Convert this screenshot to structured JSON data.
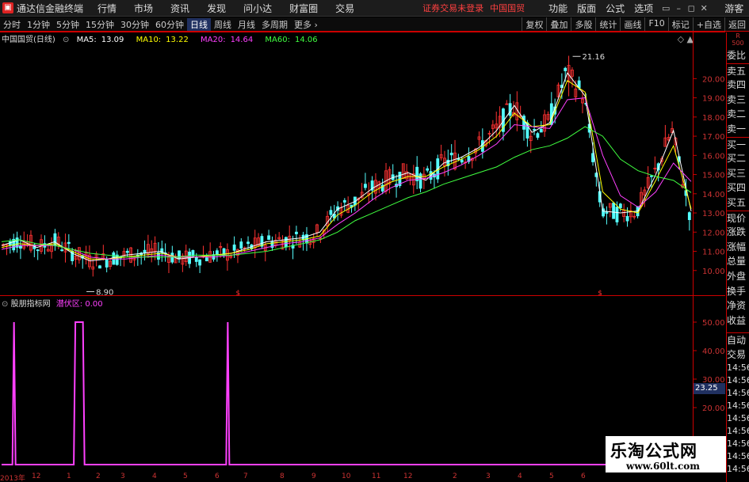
{
  "app": {
    "title": "通达信金融终端",
    "logo_glyph": "▣",
    "menu": [
      "行情",
      "市场",
      "资讯",
      "发现",
      "问小达",
      "财富圈",
      "交易"
    ],
    "login_status": "证券交易未登录",
    "stock_title": "中国国贸",
    "functions": [
      "功能",
      "版面",
      "公式",
      "选项"
    ],
    "window_buttons": [
      "▭",
      "–",
      "◻",
      "✕"
    ],
    "guest": "游客"
  },
  "toolbar": {
    "periods": [
      "分时",
      "1分钟",
      "5分钟",
      "15分钟",
      "30分钟",
      "60分钟",
      "日线",
      "周线",
      "月线",
      "多周期",
      "更多 ›"
    ],
    "active_period": "日线",
    "right_buttons": [
      "复权",
      "叠加",
      "多股",
      "统计",
      "画线",
      "F10",
      "标记",
      "+自选",
      "返回"
    ]
  },
  "main_chart": {
    "stock_label": "中国国贸(日线)",
    "ma": [
      {
        "label": "MA5:",
        "value": "13.09",
        "color": "#ffffff"
      },
      {
        "label": "MA10:",
        "value": "13.22",
        "color": "#ffff00"
      },
      {
        "label": "MA20:",
        "value": "14.64",
        "color": "#ff40ff"
      },
      {
        "label": "MA60:",
        "value": "14.06",
        "color": "#40ff40"
      }
    ],
    "controls": "◇ ▲",
    "y_ticks": [
      "20.00",
      "19.00",
      "18.00",
      "17.00",
      "16.00",
      "15.00",
      "14.00",
      "13.00",
      "12.00",
      "11.00",
      "10.00"
    ],
    "high_label": "21.16",
    "low_label": "8.90",
    "markers": [
      "$",
      "$"
    ]
  },
  "indicator": {
    "name": "股朋指标网",
    "series_label": "潜伏区:",
    "series_value": "0.00",
    "y_ticks": [
      "50.00",
      "40.00",
      "30.00",
      "20.00"
    ]
  },
  "dates": [
    "2013年",
    "12",
    "1",
    "2",
    "3",
    "4",
    "5",
    "6",
    "7",
    "8",
    "9",
    "10",
    "11",
    "12",
    "2",
    "3",
    "4",
    "5",
    "6"
  ],
  "side_panel": {
    "top_r": "R",
    "top_num": "500",
    "labels": [
      "委比",
      "卖五",
      "卖四",
      "卖三",
      "卖二",
      "卖一",
      "买一",
      "买二",
      "买三",
      "买四",
      "买五",
      "现价",
      "涨跌",
      "涨幅",
      "总量",
      "外盘",
      "换手",
      "净资",
      "收益"
    ],
    "labels2": [
      "自动",
      "交易"
    ],
    "price_box": "23.25",
    "times": [
      "14:56",
      "14:56",
      "14:56",
      "14:56",
      "14:56",
      "14:56",
      "14:56",
      "14:56",
      "14:56"
    ]
  },
  "watermark": {
    "title": "乐淘公式网",
    "url": "www.60lt.com"
  },
  "chart_data": {
    "type": "line",
    "title": "中国国贸(日线)",
    "ylim": [
      9.0,
      21.5
    ],
    "series": [
      {
        "name": "MA5",
        "values": [
          11.3,
          11.6,
          11.2,
          11.5,
          10.9,
          10.5,
          10.6,
          10.8,
          10.9,
          11.0,
          10.6,
          10.7,
          10.8,
          10.9,
          11.2,
          11.5,
          11.6,
          11.7,
          12.0,
          13.2,
          13.6,
          14.3,
          14.8,
          15.1,
          14.7,
          15.6,
          15.9,
          16.4,
          17.3,
          18.6,
          17.2,
          17.7,
          20.3,
          19.1,
          13.1,
          13.0,
          13.1,
          15.0,
          17.3,
          13.09
        ]
      },
      {
        "name": "MA10",
        "values": [
          11.2,
          11.4,
          11.3,
          11.4,
          11.0,
          10.6,
          10.6,
          10.7,
          10.8,
          10.9,
          10.7,
          10.7,
          10.8,
          10.9,
          11.1,
          11.4,
          11.5,
          11.6,
          11.8,
          12.9,
          13.4,
          14.1,
          14.6,
          14.9,
          14.9,
          15.4,
          15.8,
          16.3,
          17.0,
          18.2,
          17.5,
          17.6,
          19.9,
          19.3,
          14.1,
          13.2,
          13.0,
          14.7,
          16.5,
          13.22
        ]
      },
      {
        "name": "MA20",
        "values": [
          11.1,
          11.3,
          11.3,
          11.3,
          11.1,
          10.7,
          10.6,
          10.6,
          10.7,
          10.8,
          10.7,
          10.7,
          10.7,
          10.8,
          11.0,
          11.2,
          11.4,
          11.5,
          11.7,
          12.4,
          13.0,
          13.7,
          14.3,
          14.7,
          14.8,
          15.1,
          15.5,
          16.0,
          16.6,
          17.6,
          17.5,
          17.4,
          18.9,
          19.0,
          16.0,
          13.9,
          13.3,
          14.1,
          15.6,
          14.64
        ]
      },
      {
        "name": "MA60",
        "values": [
          11.5,
          11.6,
          11.4,
          11.3,
          11.1,
          10.9,
          10.8,
          10.7,
          10.7,
          10.7,
          10.7,
          10.8,
          10.8,
          10.8,
          10.9,
          11.0,
          11.2,
          11.4,
          11.6,
          12.0,
          12.6,
          13.0,
          13.4,
          13.8,
          14.1,
          14.5,
          14.8,
          15.1,
          15.4,
          15.9,
          16.3,
          16.5,
          16.9,
          17.5,
          17.0,
          15.8,
          15.2,
          14.9,
          14.7,
          14.06
        ]
      }
    ],
    "price_high": 21.16,
    "price_low": 8.9,
    "indicator_series": {
      "name": "潜伏区",
      "spikes_at": [
        0.018,
        0.107,
        0.118,
        0.328
      ],
      "peak": 50,
      "current": 0.0
    }
  }
}
